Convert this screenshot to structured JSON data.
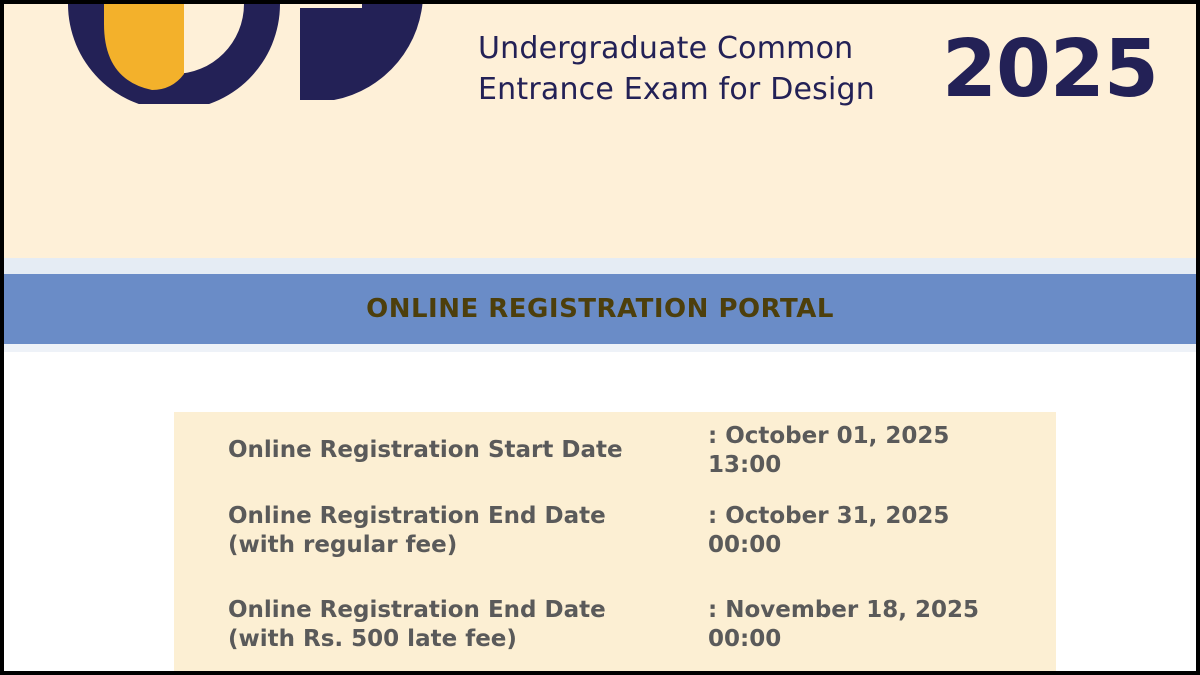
{
  "header": {
    "title_line1": "Undergraduate Common",
    "title_line2": "Entrance Exam for Design",
    "year": "2025",
    "colors": {
      "navy": "#232156",
      "orange": "#f3b12b",
      "cream": "#fef0d8"
    },
    "logo_icon": "uceed-logo"
  },
  "banner": {
    "title": "ONLINE REGISTRATION PORTAL",
    "background": "#6a8cc7",
    "text_color": "#4d3f0c"
  },
  "dates": [
    {
      "label_line1": "Online Registration Start Date",
      "label_line2": "",
      "value_line1": ": October 01, 2025",
      "value_line2": "13:00"
    },
    {
      "label_line1": "Online Registration End Date",
      "label_line2": "(with regular fee)",
      "value_line1": ": October 31, 2025",
      "value_line2": "00:00"
    },
    {
      "label_line1": "Online Registration End Date",
      "label_line2": "(with Rs. 500 late fee)",
      "value_line1": ": November 18, 2025",
      "value_line2": "00:00"
    }
  ]
}
